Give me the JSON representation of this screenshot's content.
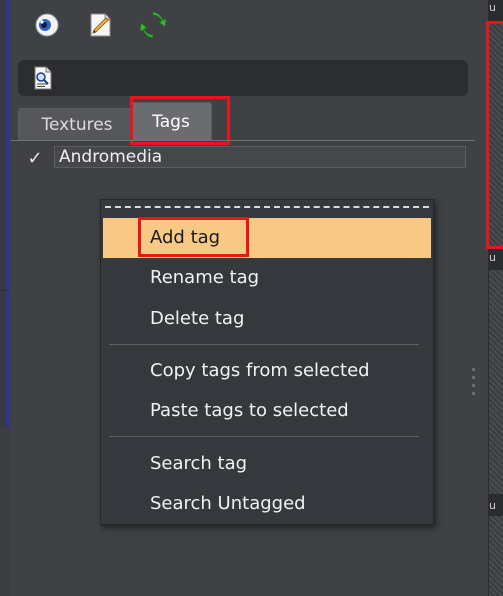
{
  "toolbar": {
    "icons": [
      "eye-icon",
      "edit-document-icon",
      "refresh-icon"
    ]
  },
  "search_bar": {
    "icon": "document-search-icon"
  },
  "tabs": [
    {
      "label": "Textures",
      "active": false
    },
    {
      "label": "Tags",
      "active": true
    }
  ],
  "tag_list": [
    {
      "name": "Andromedia",
      "checked": true,
      "check_glyph": "✓"
    }
  ],
  "context_menu": {
    "items": [
      {
        "label": "Add tag",
        "highlighted": true
      },
      {
        "label": "Rename tag"
      },
      {
        "label": "Delete tag"
      },
      {
        "label": "Copy tags from selected"
      },
      {
        "label": "Paste tags to selected"
      },
      {
        "label": "Search tag"
      },
      {
        "label": "Search Untagged"
      }
    ]
  },
  "right_column": {
    "labels": [
      "u",
      "u",
      "u"
    ]
  },
  "colors": {
    "highlight_red": "#e8161b",
    "menu_hover": "#f7c984",
    "panel_bg": "#3f4144"
  }
}
